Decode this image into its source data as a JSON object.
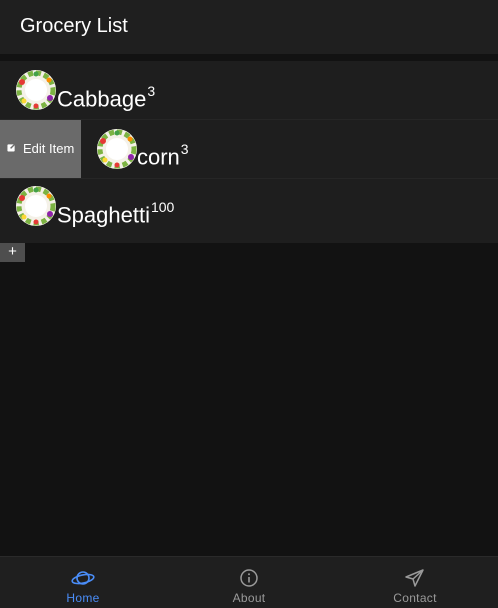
{
  "header": {
    "title": "Grocery List"
  },
  "items": [
    {
      "name": "Cabbage",
      "quantity": "3"
    },
    {
      "name": "corn",
      "quantity": "3"
    },
    {
      "name": "Spaghetti",
      "quantity": "100"
    }
  ],
  "slide_option": {
    "label": "Edit Item",
    "icon": "edit-icon"
  },
  "add_button": {
    "label": "+"
  },
  "tabs": [
    {
      "label": "Home",
      "icon": "planet-icon",
      "active": true
    },
    {
      "label": "About",
      "icon": "info-icon",
      "active": false
    },
    {
      "label": "Contact",
      "icon": "send-icon",
      "active": false
    }
  ],
  "colors": {
    "active_tab": "#4a8df8",
    "inactive_tab": "#9a9a9a",
    "background": "#121212",
    "surface": "#1e1e1e",
    "slide_option_bg": "#6a6a6a"
  }
}
